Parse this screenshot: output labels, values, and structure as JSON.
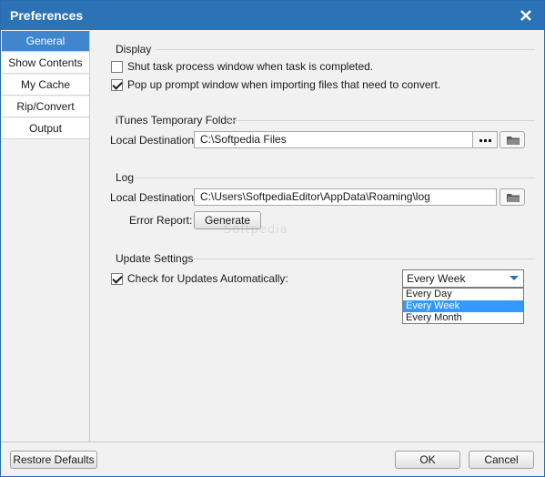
{
  "window": {
    "title": "Preferences"
  },
  "sidebar": {
    "items": [
      {
        "label": "General",
        "active": true
      },
      {
        "label": "Show Contents",
        "active": false
      },
      {
        "label": "My Cache",
        "active": false
      },
      {
        "label": "Rip/Convert",
        "active": false
      },
      {
        "label": "Output",
        "active": false
      }
    ]
  },
  "display": {
    "heading": "Display",
    "shut_task_label": "Shut task process window when task is completed.",
    "shut_task_checked": false,
    "popup_label": "Pop up prompt window when importing files that need to convert.",
    "popup_checked": true
  },
  "itunes": {
    "heading": "iTunes Temporary Folder",
    "dest_label": "Local Destination:",
    "dest_value": "C:\\Softpedia Files"
  },
  "log": {
    "heading": "Log",
    "dest_label": "Local Destination:",
    "dest_value": "C:\\Users\\SoftpediaEditor\\AppData\\Roaming\\log",
    "error_label": "Error Report:",
    "generate_label": "Generate"
  },
  "update": {
    "heading": "Update Settings",
    "check_label": "Check for Updates Automatically:",
    "check_checked": true,
    "selected": "Every Week",
    "options": [
      "Every Day",
      "Every Week",
      "Every Month"
    ]
  },
  "footer": {
    "restore_label": "Restore Defaults",
    "ok_label": "OK",
    "cancel_label": "Cancel"
  },
  "watermark": {
    "text": "Softpedia"
  },
  "colors": {
    "titlebar": "#2c73b6",
    "active_tab": "#3f86cc",
    "selected_option": "#3399ff"
  }
}
